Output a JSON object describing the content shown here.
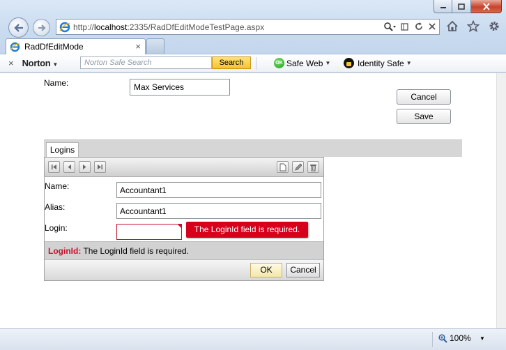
{
  "browser": {
    "url_prefix": "http://",
    "url_host": "localhost",
    "url_rest": ":2335/RadDfEditModeTestPage.aspx",
    "tab_title": "RadDfEditMode",
    "tab_close": "×"
  },
  "norton": {
    "close": "×",
    "brand": "Norton",
    "caret": "▼",
    "search_placeholder": "Norton Safe Search",
    "search_button": "Search",
    "ok_badge": "OK",
    "safe_web": "Safe Web",
    "identity_safe": "Identity Safe"
  },
  "form": {
    "name_label": "Name:",
    "name_value": "Max Services",
    "cancel_label": "Cancel",
    "save_label": "Save"
  },
  "tabs": [
    {
      "label": "Logins"
    }
  ],
  "dataform": {
    "name_label": "Name:",
    "name_value": "Accountant1",
    "alias_label": "Alias:",
    "alias_value": "Accountant1",
    "login_label": "Login:",
    "login_value": "",
    "error_tooltip": "The LoginId field is required.",
    "summary_field": "LoginId:",
    "summary_text": "The LoginId field is required.",
    "ok_label": "OK",
    "cancel_label": "Cancel"
  },
  "status": {
    "zoom": "100%"
  },
  "colors": {
    "error": "#d6001c",
    "norton_search_button": "#f8c22c"
  }
}
